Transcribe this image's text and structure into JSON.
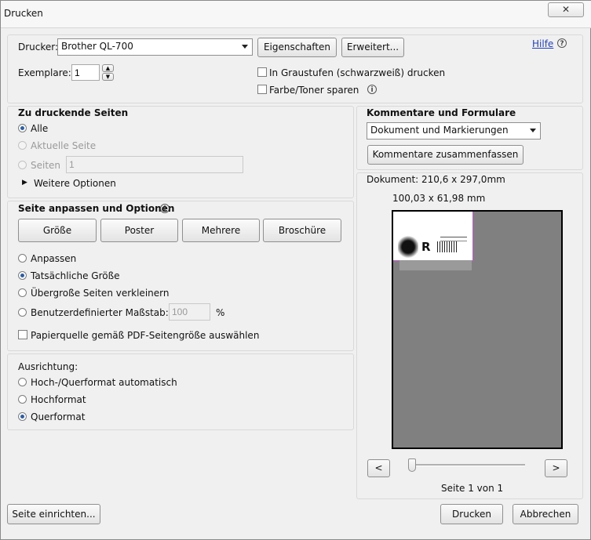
{
  "window": {
    "title": "Drucken",
    "close_glyph": "✕"
  },
  "printer": {
    "label": "Drucker:",
    "selected": "Brother QL-700",
    "properties_button": "Eigenschaften",
    "advanced_button": "Erweitert...",
    "help_link": "Hilfe",
    "copies_label": "Exemplare:",
    "copies_value": "1",
    "grayscale_label": "In Graustufen (schwarzweiß) drucken",
    "save_toner_label": "Farbe/Toner sparen"
  },
  "pages": {
    "heading": "Zu druckende Seiten",
    "all": "Alle",
    "current": "Aktuelle Seite",
    "pages": "Seiten",
    "pages_value": "1",
    "more_options": "Weitere Optionen"
  },
  "fit": {
    "heading": "Seite anpassen und Optionen",
    "tabs": [
      "Größe",
      "Poster",
      "Mehrere",
      "Broschüre"
    ],
    "fit_option": "Anpassen",
    "actual_size": "Tatsächliche Größe",
    "shrink": "Übergroße Seiten verkleinern",
    "custom_scale": "Benutzerdefinierter Maßstab:",
    "scale_value": "100",
    "percent": "%",
    "paper_source": "Papierquelle gemäß PDF-Seitengröße auswählen"
  },
  "orientation": {
    "heading": "Ausrichtung:",
    "auto": "Hoch-/Querformat automatisch",
    "portrait": "Hochformat",
    "landscape": "Querformat"
  },
  "comments": {
    "heading": "Kommentare und Formulare",
    "selected": "Dokument und Markierungen",
    "summarize_button": "Kommentare zusammenfassen"
  },
  "preview": {
    "document_size": "Dokument: 210,6 x 297,0mm",
    "paper_size": "100,03 x 61,98 mm",
    "prev": "<",
    "next": ">",
    "page_indicator": "Seite 1 von 1",
    "label_letter": "R"
  },
  "footer": {
    "page_setup": "Seite einrichten...",
    "print": "Drucken",
    "cancel": "Abbrechen"
  },
  "colors": {
    "accent_radio": "#2a5fa8",
    "preview_bg": "#808080",
    "link": "#1f3fbf"
  }
}
